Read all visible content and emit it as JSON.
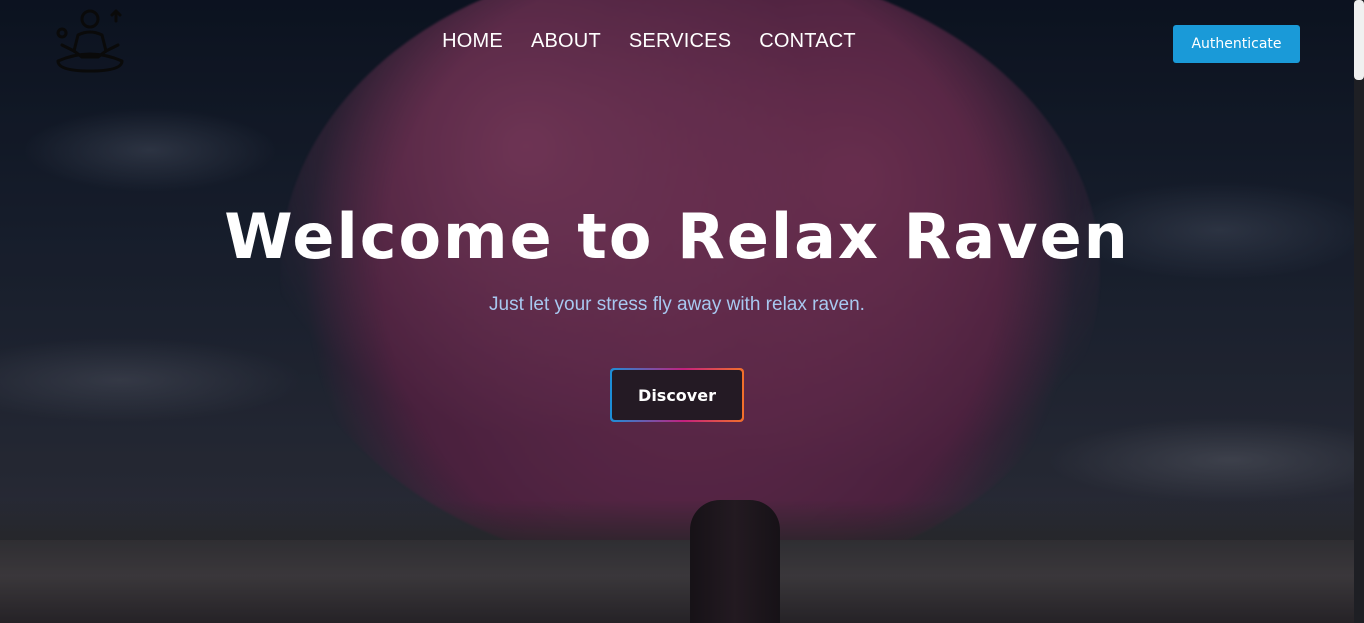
{
  "brand": {
    "logo_icon": "meditation-person-icon"
  },
  "nav": {
    "items": [
      {
        "label": "HOME"
      },
      {
        "label": "ABOUT"
      },
      {
        "label": "SERVICES"
      },
      {
        "label": "CONTACT"
      }
    ]
  },
  "header": {
    "auth_label": "Authenticate"
  },
  "hero": {
    "title": "Welcome to Relax Raven",
    "subtitle": "Just let your stress fly away with relax raven.",
    "cta_label": "Discover"
  },
  "colors": {
    "accent_blue": "#1a9ad8",
    "gradient_start": "#1b8fd8",
    "gradient_mid": "#c4207e",
    "gradient_end": "#f2702a",
    "subtitle": "#a8c8f0"
  }
}
